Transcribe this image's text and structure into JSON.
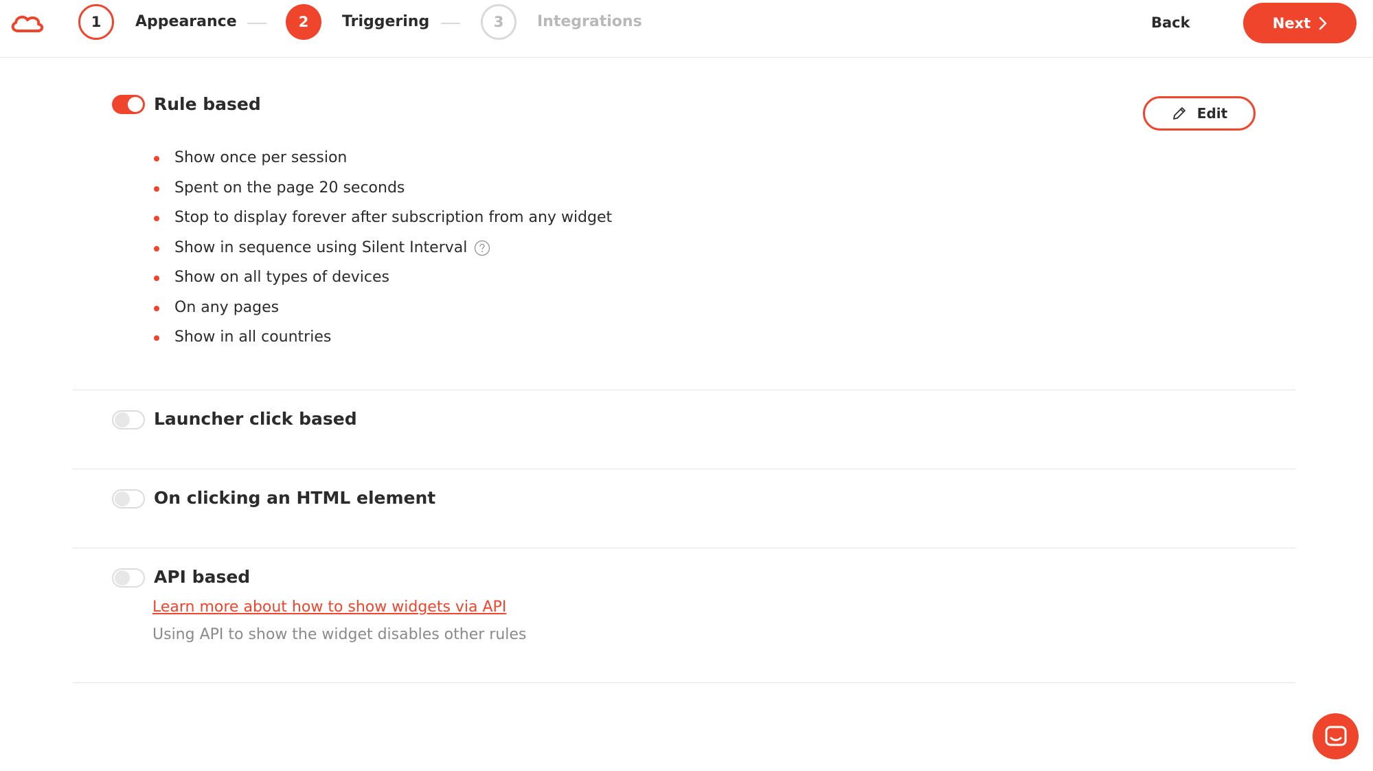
{
  "steps": [
    {
      "number": "1",
      "label": "Appearance",
      "state": "done"
    },
    {
      "number": "2",
      "label": "Triggering",
      "state": "active"
    },
    {
      "number": "3",
      "label": "Integrations",
      "state": "pending"
    }
  ],
  "header": {
    "back_label": "Back",
    "next_label": "Next"
  },
  "sections": {
    "rule_based": {
      "title": "Rule based",
      "enabled": true,
      "edit_label": "Edit",
      "rules": [
        "Show once per session",
        "Spent on the page 20 seconds",
        "Stop to display forever after subscription from any widget",
        "Show in sequence using Silent Interval",
        "Show on all types of devices",
        "On any pages",
        "Show in all countries"
      ]
    },
    "launcher_click": {
      "title": "Launcher click based",
      "enabled": false
    },
    "html_element": {
      "title": "On clicking an HTML element",
      "enabled": false
    },
    "api_based": {
      "title": "API based",
      "enabled": false,
      "link_text": "Learn more about how to show widgets via API",
      "note": "Using API to show the widget disables other rules"
    }
  },
  "colors": {
    "accent": "#f0452d",
    "text": "#2b2b2b",
    "muted": "#b9b9b9",
    "divider": "#e4e4e4"
  },
  "icons": [
    "logo-icon",
    "chevron-right-icon",
    "pencil-icon",
    "help-icon",
    "chat-icon"
  ]
}
